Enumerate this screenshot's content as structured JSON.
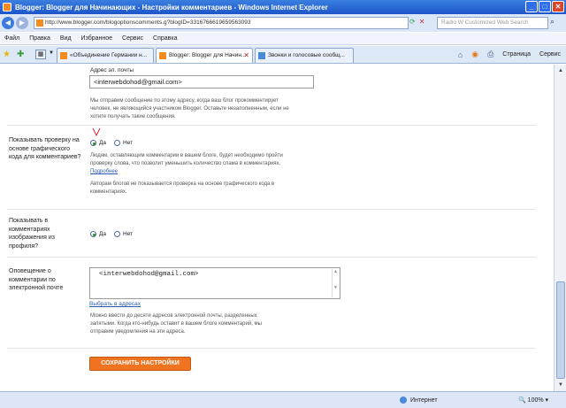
{
  "window": {
    "title": "Blogger: Blogger для Начинающих - Настройки комментариев - Windows Internet Explorer",
    "min": "_",
    "max": "□",
    "close": "✕"
  },
  "address": {
    "url": "http://www.blogger.com/blogoptionscomments.g?blogID=3316766619659563093",
    "search_placeholder": "Radio W Customized Web Search"
  },
  "menu": [
    "Файл",
    "Правка",
    "Вид",
    "Избранное",
    "Сервис",
    "Справка"
  ],
  "tabs": [
    {
      "label": "«Объединение Германии н...",
      "active": false
    },
    {
      "label": "Blogger: Blogger для Начин...",
      "active": true
    },
    {
      "label": "Звонки и голосовые сообщ...",
      "active": false
    }
  ],
  "commands": {
    "page": "Страница",
    "tools": "Сервис"
  },
  "form": {
    "email_label": "Адрес эл. почты",
    "email_value": "<interwebdohod@gmail.com>",
    "email_note": "Мы отправим сообщение по этому адресу, когда ваш блог прокомментирует человек, не являющийся участником Blogger. Оставьте незаполненным, если не хотите получать такие сообщения.",
    "captcha_label": "Показывать проверку на основе графического кода для комментариев?",
    "yes": "Да",
    "no": "Нет",
    "captcha_note": "Людям, оставляющим комментарии в вашем блоге, будет необходимо пройти проверку слова, что позволит уменьшить количество спама в комментариях.",
    "more_link": "Подробнее",
    "captcha_note2": "Авторам блогов не показывается проверка на основе графического кода в комментариях.",
    "profile_images_label": "Показывать в комментариях изображения из профиля?",
    "notify_label": "Оповещение о комментарии по электронной почте",
    "notify_value": "<interwebdohod@gmail.com>",
    "choose_link": "Выбрать в адресах",
    "notify_note": "Можно ввести до десяти адресов электронной почты, разделенных запятыми. Когда кто-нибудь оставит в вашем блоге комментарий, мы отправим уведомления на эти адреса.",
    "save_button": "СОХРАНИТЬ НАСТРОЙКИ"
  },
  "status": {
    "zone": "Интернет",
    "zoom": "100%"
  }
}
